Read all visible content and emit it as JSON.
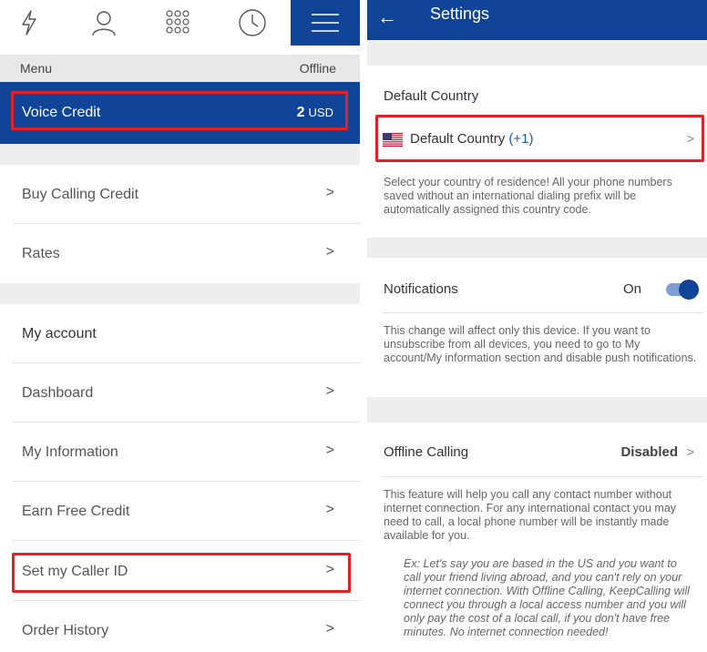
{
  "left": {
    "strip": {
      "left": "Menu",
      "right": "Offline"
    },
    "credit": {
      "label": "Voice Credit",
      "amount": "2",
      "currency": "USD"
    },
    "rows": {
      "buy": "Buy Calling Credit",
      "rates": "Rates",
      "account_heading": "My account",
      "dashboard": "Dashboard",
      "info": "My Information",
      "earn": "Earn Free Credit",
      "caller_id": "Set my Caller ID",
      "orders": "Order History"
    },
    "chevron": ">"
  },
  "right": {
    "title": "Settings",
    "back_glyph": "←",
    "default_country": {
      "section": "Default Country",
      "row_label": "Default Country",
      "row_code": "(+1)",
      "chevron": ">",
      "note": "Select your country of residence! All your phone numbers saved without an international dialing prefix will be automatically assigned this country code."
    },
    "notifications": {
      "label": "Notifications",
      "state_label": "On",
      "state": true,
      "note": "This change will affect only this device. If you want to unsubscribe from all devices, you need to go to My account/My information section and disable push notifications."
    },
    "offline_calling": {
      "label": "Offline Calling",
      "value": "Disabled",
      "chevron": ">",
      "note": "This feature will help you call any contact number without internet connection. For any international contact you may need to call, a local phone number will be instantly made available for you.",
      "example": "Ex: Let's say you are based in the US and you want to call your friend living abroad, and you can't rely on your internet connection. With Offline Calling, KeepCalling will connect you through a local access number and you will only pay the cost of a local call, if you don't have free minutes. No internet connection needed!"
    }
  },
  "colors": {
    "brand_blue": "#0f4499",
    "highlight_red": "#e32026",
    "link_blue": "#1c5bb0"
  },
  "icons": [
    "flash-icon",
    "contact-icon",
    "dialpad-icon",
    "history-clock-icon",
    "hamburger-menu-icon",
    "back-arrow-icon",
    "us-flag-icon",
    "chevron-right-icon"
  ]
}
